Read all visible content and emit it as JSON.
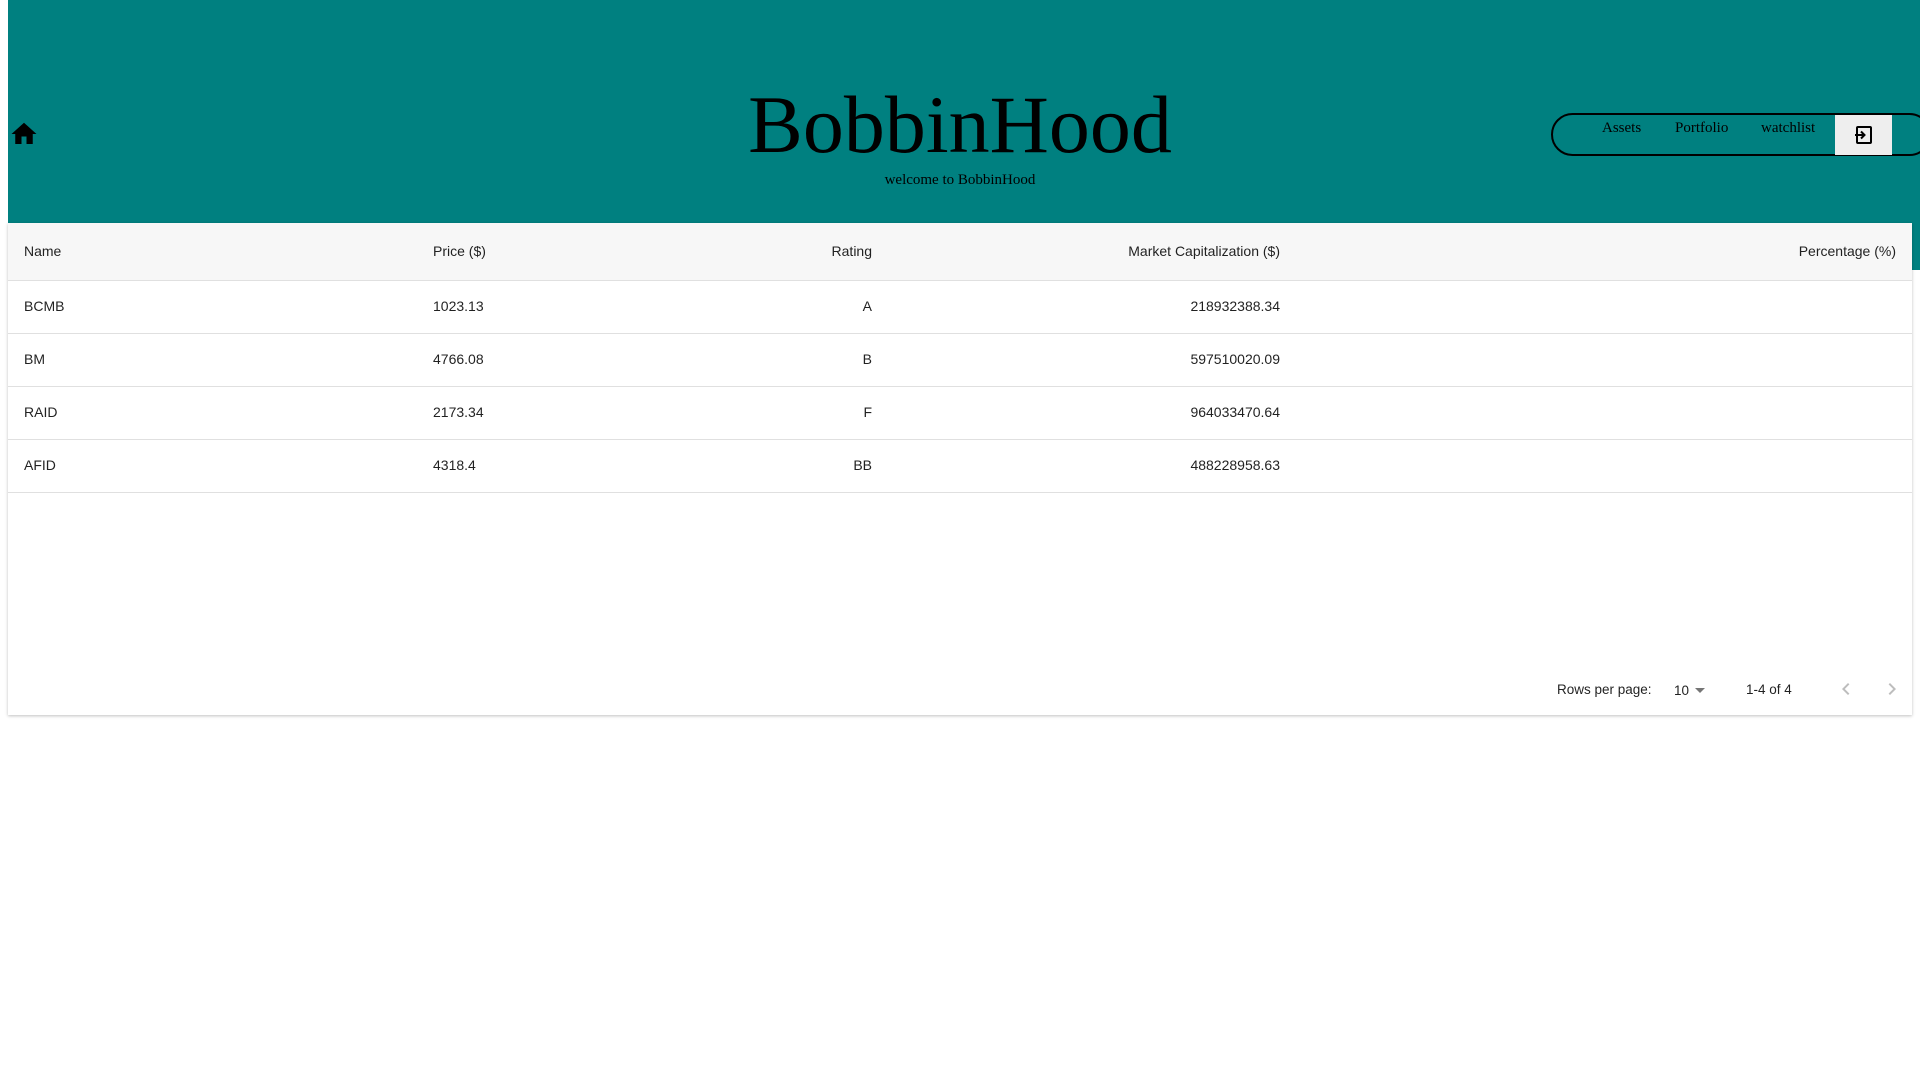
{
  "header": {
    "title": "BobbinHood",
    "subtitle": "welcome to BobbinHood",
    "background_color": "#008080",
    "home_icon": "home-icon",
    "nav": {
      "items": [
        {
          "label": "Assets"
        },
        {
          "label": "Portfolio"
        },
        {
          "label": "watchlist"
        }
      ],
      "logout_icon": "logout-icon"
    }
  },
  "table": {
    "columns": [
      "Name",
      "Price ($)",
      "Rating",
      "Market Capitalization ($)",
      "Percentage (%)"
    ],
    "rows": [
      {
        "name": "BCMB",
        "price": "1023.13",
        "rating": "A",
        "market_cap": "218932388.34",
        "percentage": ""
      },
      {
        "name": "BM",
        "price": "4766.08",
        "rating": "B",
        "market_cap": "597510020.09",
        "percentage": ""
      },
      {
        "name": "RAID",
        "price": "2173.34",
        "rating": "F",
        "market_cap": "964033470.64",
        "percentage": ""
      },
      {
        "name": "AFID",
        "price": "4318.4",
        "rating": "BB",
        "market_cap": "488228958.63",
        "percentage": ""
      }
    ]
  },
  "pagination": {
    "rows_per_page_label": "Rows per page:",
    "rows_per_page_value": "10",
    "range_label": "1-4 of 4",
    "prev_icon": "chevron-left-icon",
    "next_icon": "chevron-right-icon"
  }
}
